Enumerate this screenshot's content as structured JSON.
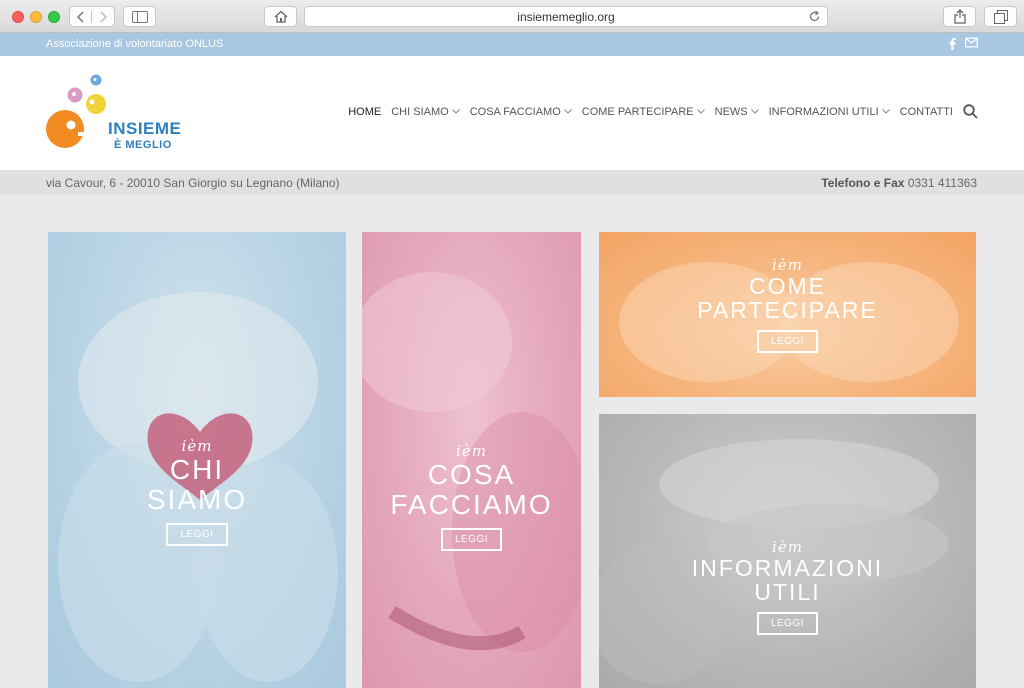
{
  "browser": {
    "url": "insiememeglio.org"
  },
  "topbar": {
    "association": "Associazione di volontariato ONLUS"
  },
  "logo": {
    "line1": "INSIEME",
    "line2": "È MEGLIO"
  },
  "nav": {
    "items": [
      {
        "label": "HOME"
      },
      {
        "label": "CHI SIAMO"
      },
      {
        "label": "COSA FACCIAMO"
      },
      {
        "label": "COME PARTECIPARE"
      },
      {
        "label": "NEWS"
      },
      {
        "label": "INFORMAZIONI UTILI"
      },
      {
        "label": "CONTATTI"
      }
    ]
  },
  "strip": {
    "address": "via Cavour, 6 - 20010 San Giorgio su Legnano (Milano)",
    "phone_label": "Telefono e Fax",
    "phone_number": "0331 411363"
  },
  "cards": [
    {
      "iem": "ièm",
      "line1": "CHI",
      "line2": "SIAMO",
      "button": "LEGGI"
    },
    {
      "iem": "ièm",
      "line1": "COSA",
      "line2": "FACCIAMO",
      "button": "LEGGI"
    },
    {
      "iem": "ièm",
      "line1": "COME",
      "line2": "PARTECIPARE",
      "button": "LEGGI"
    },
    {
      "iem": "ièm",
      "line1": "INFORMAZIONI",
      "line2": "UTILI",
      "button": "LEGGI"
    }
  ],
  "colors": {
    "topbar": "#a8c7e2",
    "card_blue": "#bcd6e6",
    "card_pink": "#e5a9bd",
    "card_orange": "#f6b47c",
    "card_grey": "#b5b5b7"
  }
}
